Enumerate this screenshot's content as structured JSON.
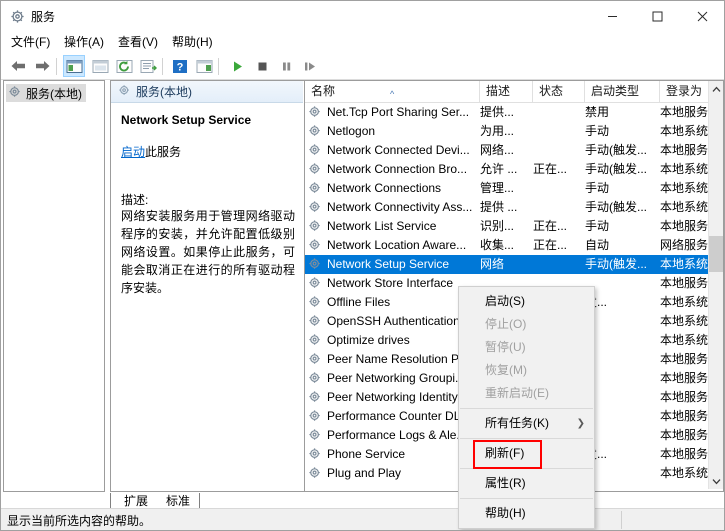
{
  "window": {
    "title": "服务",
    "title_icon": "gear-icon",
    "minimize_label": "最小化",
    "maximize_label": "最大化",
    "close_label": "关闭"
  },
  "menubar": {
    "items": [
      {
        "label": "文件(F)",
        "name": "menu-file"
      },
      {
        "label": "操作(A)",
        "name": "menu-action"
      },
      {
        "label": "查看(V)",
        "name": "menu-view"
      },
      {
        "label": "帮助(H)",
        "name": "menu-help"
      }
    ]
  },
  "toolbar": {
    "buttons": [
      {
        "name": "back-icon",
        "glyph": "←"
      },
      {
        "name": "forward-icon",
        "glyph": "→"
      },
      {
        "name": "show-hide-console-tree-icon",
        "glyph": "▤"
      },
      {
        "name": "export-list-icon",
        "glyph": "▥"
      },
      {
        "name": "refresh-icon",
        "glyph": "↻"
      },
      {
        "name": "properties-icon",
        "glyph": "▤"
      },
      {
        "name": "help-icon",
        "glyph": "?"
      },
      {
        "name": "show-action-pane-icon",
        "glyph": "▦"
      },
      {
        "name": "start-service-icon",
        "glyph": "▶"
      },
      {
        "name": "stop-service-icon",
        "glyph": "■"
      },
      {
        "name": "pause-service-icon",
        "glyph": "❚❚"
      },
      {
        "name": "restart-service-icon",
        "glyph": "❚▶"
      }
    ]
  },
  "tree": {
    "root_label": "服务(本地)",
    "root_icon": "gear-icon"
  },
  "details": {
    "header_label": "服务(本地)",
    "header_icon": "gear-icon",
    "service_title": "Network Setup Service",
    "action_link": "启动",
    "action_link_suffix": "此服务",
    "description_label": "描述:",
    "description_text": "网络安装服务用于管理网络驱动程序的安装，并允许配置低级别网络设置。如果停止此服务，可能会取消正在进行的所有驱动程序安装。"
  },
  "list": {
    "columns": [
      {
        "label": "名称",
        "name": "column-name",
        "sorted": true,
        "sort_caret": "^"
      },
      {
        "label": "描述",
        "name": "column-description"
      },
      {
        "label": "状态",
        "name": "column-status"
      },
      {
        "label": "启动类型",
        "name": "column-startup-type"
      },
      {
        "label": "登录为",
        "name": "column-log-on-as"
      }
    ],
    "rows": [
      {
        "name": "Net.Tcp Port Sharing Ser...",
        "desc": "提供...",
        "status": "",
        "startup": "禁用",
        "logon": "本地服务",
        "selected": false
      },
      {
        "name": "Netlogon",
        "desc": "为用...",
        "status": "",
        "startup": "手动",
        "logon": "本地系统",
        "selected": false
      },
      {
        "name": "Network Connected Devi...",
        "desc": "网络...",
        "status": "",
        "startup": "手动(触发...",
        "logon": "本地服务",
        "selected": false
      },
      {
        "name": "Network Connection Bro...",
        "desc": "允许 ...",
        "status": "正在...",
        "startup": "手动(触发...",
        "logon": "本地系统",
        "selected": false
      },
      {
        "name": "Network Connections",
        "desc": "管理...",
        "status": "",
        "startup": "手动",
        "logon": "本地系统",
        "selected": false
      },
      {
        "name": "Network Connectivity Ass...",
        "desc": "提供 ...",
        "status": "",
        "startup": "手动(触发...",
        "logon": "本地系统",
        "selected": false
      },
      {
        "name": "Network List Service",
        "desc": "识别...",
        "status": "正在...",
        "startup": "手动",
        "logon": "本地服务",
        "selected": false
      },
      {
        "name": "Network Location Aware...",
        "desc": "收集...",
        "status": "正在...",
        "startup": "自动",
        "logon": "网络服务",
        "selected": false
      },
      {
        "name": "Network Setup Service",
        "desc": "网络",
        "status": "",
        "startup": "手动(触发...",
        "logon": "本地系统",
        "selected": true
      },
      {
        "name": "Network Store Interface",
        "desc": "",
        "status": "",
        "startup": "",
        "logon": "本地服务",
        "selected": false
      },
      {
        "name": "Offline Files",
        "desc": "",
        "status": "",
        "startup": "发...",
        "logon": "本地系统",
        "selected": false
      },
      {
        "name": "OpenSSH Authentication",
        "desc": "",
        "status": "",
        "startup": "",
        "logon": "本地系统",
        "selected": false
      },
      {
        "name": "Optimize drives",
        "desc": "",
        "status": "",
        "startup": "",
        "logon": "本地系统",
        "selected": false
      },
      {
        "name": "Peer Name Resolution P...",
        "desc": "",
        "status": "",
        "startup": "",
        "logon": "本地服务",
        "selected": false
      },
      {
        "name": "Peer Networking Groupi...",
        "desc": "",
        "status": "",
        "startup": "",
        "logon": "本地服务",
        "selected": false
      },
      {
        "name": "Peer Networking Identity",
        "desc": "",
        "status": "",
        "startup": "",
        "logon": "本地服务",
        "selected": false
      },
      {
        "name": "Performance Counter DL...",
        "desc": "",
        "status": "",
        "startup": "",
        "logon": "本地服务",
        "selected": false
      },
      {
        "name": "Performance Logs & Ale...",
        "desc": "",
        "status": "",
        "startup": "",
        "logon": "本地服务",
        "selected": false
      },
      {
        "name": "Phone Service",
        "desc": "",
        "status": "",
        "startup": "发...",
        "logon": "本地服务",
        "selected": false
      },
      {
        "name": "Plug and Play",
        "desc": "",
        "status": "",
        "startup": "",
        "logon": "本地系统",
        "selected": false
      }
    ]
  },
  "context_menu": {
    "items": [
      {
        "label": "启动(S)",
        "name": "ctx-start",
        "disabled": false,
        "submenu": false
      },
      {
        "label": "停止(O)",
        "name": "ctx-stop",
        "disabled": true,
        "submenu": false
      },
      {
        "label": "暂停(U)",
        "name": "ctx-pause",
        "disabled": true,
        "submenu": false
      },
      {
        "label": "恢复(M)",
        "name": "ctx-resume",
        "disabled": true,
        "submenu": false
      },
      {
        "label": "重新启动(E)",
        "name": "ctx-restart",
        "disabled": true,
        "submenu": false
      },
      {
        "label": "所有任务(K)",
        "name": "ctx-all-tasks",
        "disabled": false,
        "submenu": true
      },
      {
        "label": "刷新(F)",
        "name": "ctx-refresh",
        "disabled": false,
        "submenu": false
      },
      {
        "label": "属性(R)",
        "name": "ctx-properties",
        "disabled": false,
        "submenu": false
      },
      {
        "label": "帮助(H)",
        "name": "ctx-help",
        "disabled": false,
        "submenu": false
      }
    ],
    "highlight_color": "#ff0000",
    "highlighted_item": "属性(R)"
  },
  "tabs": [
    {
      "label": "扩展",
      "name": "tab-extended",
      "active": false
    },
    {
      "label": "标准",
      "name": "tab-standard",
      "active": true
    }
  ],
  "statusbar": {
    "text": "显示当前所选内容的帮助。"
  },
  "colors": {
    "selection": "#0078d7",
    "link": "#0066cc",
    "accent_red": "#ff0000"
  }
}
